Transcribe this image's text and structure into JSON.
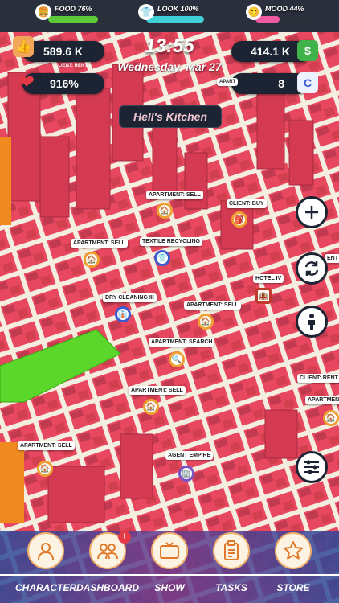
{
  "stats": {
    "food": {
      "label": "FOOD 76%",
      "level": 0.76,
      "color": "#5cc93a"
    },
    "look": {
      "label": "LOOK 100%",
      "level": 1.0,
      "color": "#3fd0d8"
    },
    "mood": {
      "label": "MOOD 44%",
      "level": 0.44,
      "color": "#f05aa0"
    }
  },
  "left_panel": {
    "money": "589.6 K",
    "health": "916%",
    "client_rent": "CLIENT: RENT"
  },
  "clock": {
    "time": "13:55",
    "date": "Wednesday, Mar 27"
  },
  "right_panel": {
    "cash": "414.1 K",
    "cards": "8"
  },
  "district": "Hell's Kitchen",
  "map_tags": {
    "t1": "APARTMENT: SELL",
    "t2": "CLIENT: BUY",
    "t3": "APARTMENT: SELL",
    "t4": "TEXTILE RECYCLING",
    "t5": "HOTEL IV",
    "t6": "DRY CLEANING III",
    "t7": "APARTMENT: SELL",
    "t8": "APARTMENT: SEARCH",
    "t9": "CLIENT: RENT",
    "t10": "APARTMENT: SELL",
    "t11": "APARTMENT",
    "t12": "AGENT EMPIRE",
    "t13": "APARTMENT: SELL",
    "t14": "APART",
    "t15": "ENT"
  },
  "nav": {
    "character": "CHARACTER",
    "dashboard": "DASHBOARD",
    "show": "SHOW",
    "tasks": "TASKS",
    "store": "STORE",
    "dashboard_badge": "!"
  },
  "colors": {
    "buildings": "#e8485f",
    "streets": "#f3eedf",
    "park": "#5bd62a"
  },
  "icons": [
    "hand-icon",
    "heart-icon",
    "cash-icon",
    "card-icon",
    "plus-icon",
    "sync-icon",
    "person-icon",
    "menu-icon",
    "user-icon",
    "group-icon",
    "tv-icon",
    "clipboard-icon",
    "star-icon"
  ]
}
